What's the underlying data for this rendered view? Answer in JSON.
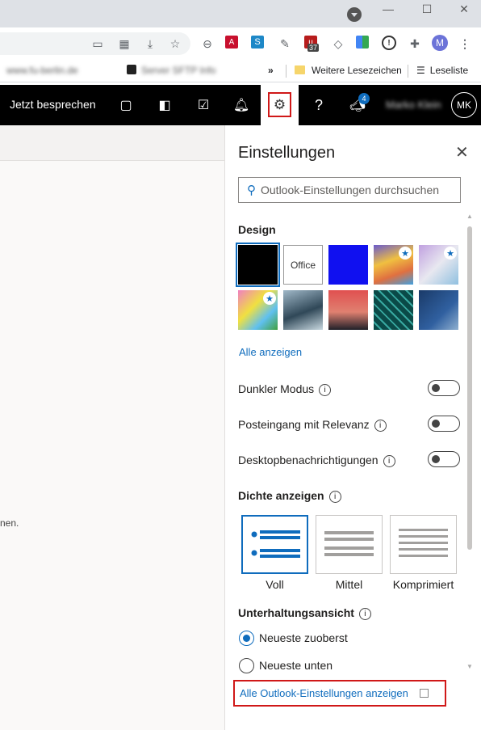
{
  "browser": {
    "bookmarks": {
      "item1": "www.fu-berlin.de",
      "item2": "Server SFTP Info",
      "overflow": "»",
      "folder": "Weitere Lesezeichen",
      "reading_list": "Leseliste"
    },
    "extension_badge": "37",
    "profile_initial": "M"
  },
  "outlook": {
    "meet_now": "Jetzt besprechen",
    "notification_count": "4",
    "user_name": "Marko Klein",
    "user_initials": "MK",
    "left_snippet": "nen."
  },
  "settings": {
    "title": "Einstellungen",
    "close": "✕",
    "search_placeholder": "Outlook-Einstellungen durchsuchen",
    "design_label": "Design",
    "office_theme": "Office",
    "show_all": "Alle anzeigen",
    "dark_mode": "Dunkler Modus",
    "focused_inbox": "Posteingang mit Relevanz",
    "desktop_notifications": "Desktopbenachrichtigungen",
    "density_label": "Dichte anzeigen",
    "density": [
      "Voll",
      "Mittel",
      "Komprimiert"
    ],
    "conversation_label": "Unterhaltungsansicht",
    "newest_top": "Neueste zuoberst",
    "newest_bottom": "Neueste unten",
    "all_settings_link": "Alle Outlook-Einstellungen anzeigen",
    "info": "i"
  },
  "colors": {
    "accent": "#0f6cbd",
    "highlight_box": "#d01818",
    "header_bg": "#000000"
  }
}
